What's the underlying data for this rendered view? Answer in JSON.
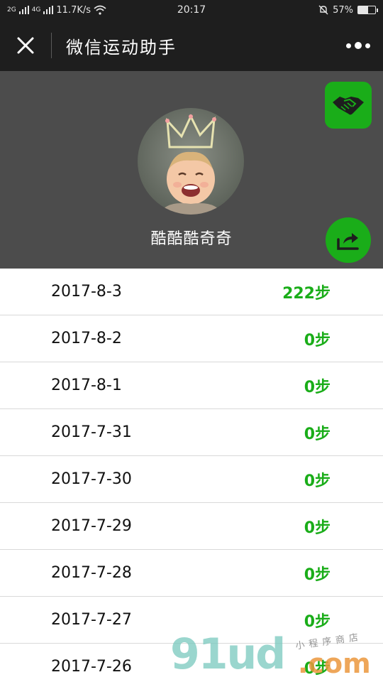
{
  "status_bar": {
    "network_1": "2G",
    "network_2": "4G",
    "speed": "11.7K/s",
    "time": "20:17",
    "battery": "57%",
    "battery_level": 0.57
  },
  "nav": {
    "title": "微信运动助手"
  },
  "profile": {
    "name": "酷酷酷奇奇"
  },
  "colors": {
    "accent": "#1aad19",
    "nav_bg": "#1e1e1e",
    "header_bg": "#4c4c4c"
  },
  "records": [
    {
      "date": "2017-8-3",
      "steps": "222步"
    },
    {
      "date": "2017-8-2",
      "steps": "0步"
    },
    {
      "date": "2017-8-1",
      "steps": "0步"
    },
    {
      "date": "2017-7-31",
      "steps": "0步"
    },
    {
      "date": "2017-7-30",
      "steps": "0步"
    },
    {
      "date": "2017-7-29",
      "steps": "0步"
    },
    {
      "date": "2017-7-28",
      "steps": "0步"
    },
    {
      "date": "2017-7-27",
      "steps": "0步"
    },
    {
      "date": "2017-7-26",
      "steps": "0步"
    }
  ],
  "watermark": {
    "main": "91ud",
    "sub": "小程序商店",
    "com": ".com"
  }
}
